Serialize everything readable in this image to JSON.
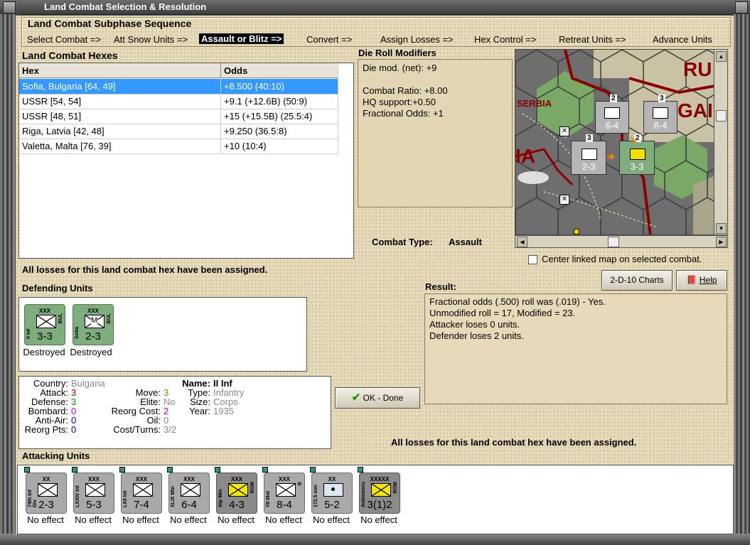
{
  "window": {
    "title": "Land Combat Selection & Resolution"
  },
  "subphase": {
    "title": "Land Combat Subphase Sequence",
    "steps": [
      "Select Combat =>",
      "Att Snow Units =>",
      "Assault or Blitz =>",
      "Convert =>",
      "Assign Losses =>",
      "Hex Control =>",
      "Retreat Units =>",
      "Advance Units"
    ],
    "active_index": 2
  },
  "hexes": {
    "title": "Land Combat Hexes",
    "columns": [
      "Hex",
      "Odds"
    ],
    "rows": [
      {
        "hex": "Sofia, Bulgaria [64, 49]",
        "odds": "+8.500 (40:10)"
      },
      {
        "hex": "USSR [54, 54]",
        "odds": "+9.1 (+12.6B) (50:9)"
      },
      {
        "hex": "USSR [48, 51]",
        "odds": "+15 (+15.5B) (25.5:4)"
      },
      {
        "hex": "Riga, Latvia [42, 48]",
        "odds": "+9.250 (36.5:8)"
      },
      {
        "hex": "Valetta, Malta [76, 39]",
        "odds": "+10 (10:4)"
      }
    ],
    "selected_index": 0
  },
  "drm": {
    "title": "Die Roll Modifiers",
    "lines": [
      "Die mod. (net): +9",
      "",
      "Combat Ratio: +8.00",
      "HQ support:+0.50",
      "Fractional Odds: +1"
    ]
  },
  "map": {
    "labels": [
      "RU",
      "GAI",
      "SERBIA",
      "IA"
    ],
    "counters": [
      {
        "top": "2",
        "str": "6-4"
      },
      {
        "top": "3",
        "str": "8-4"
      },
      {
        "top": "3",
        "str": "2-3"
      },
      {
        "top": "2",
        "str": "3-3"
      }
    ]
  },
  "combat_type": {
    "label": "Combat Type:",
    "value": "Assault"
  },
  "center_linked": {
    "label": "Center linked map on selected combat.",
    "checked": false
  },
  "losses_msg_top": "All losses for this land combat hex have been assigned.",
  "defending": {
    "title": "Defending Units",
    "units": [
      {
        "size": "XXX",
        "name": "II Inf",
        "nation": "BUL",
        "str": "3-3",
        "status": "Destroyed",
        "mark": ""
      },
      {
        "size": "XXX",
        "name": "Sofia",
        "nation": "BUL",
        "str": "2-3",
        "status": "Destroyed",
        "mark": "M"
      }
    ]
  },
  "buttons": {
    "charts": "2-D-10 Charts",
    "help": "Help",
    "done": "OK - Done"
  },
  "result": {
    "title": "Result:",
    "lines": [
      "Fractional odds (.500) roll was (.019)  - Yes.",
      "Unmodified roll = 17, Modified = 23.",
      "Attacker loses 0 units.",
      "Defender loses 2 units."
    ]
  },
  "unit_info": {
    "country_label": "Country:",
    "country": "Bulgaria",
    "attack_label": "Attack:",
    "attack": "3",
    "defense_label": "Defense:",
    "defense": "3",
    "bombard_label": "Bombard:",
    "bombard": "0",
    "antiair_label": "Anti-Air:",
    "antiair": "0",
    "reorgpts_label": "Reorg Pts:",
    "reorgpts": "0",
    "move_label": "Move:",
    "move": "3",
    "elite_label": "Elite:",
    "elite": "No",
    "reorgcost_label": "Reorg Cost:",
    "reorgcost": "2",
    "oil_label": "Oil:",
    "oil": "0",
    "costturns_label": "Cost/Turns:",
    "costturns": "3/2",
    "name_label": "Name:",
    "name": "II Inf",
    "type_label": "Type:",
    "type": "Infantry",
    "size_label": "Size:",
    "size": "Corps",
    "year_label": "Year:",
    "year": "1935"
  },
  "losses_msg_bottom": "All losses for this land combat hex have been assigned.",
  "attacking": {
    "title": "Attacking Units",
    "units": [
      {
        "size": "XX",
        "name": "74th Inf Div",
        "nation": "",
        "str": "2-3",
        "status": "No effect",
        "style": "grey"
      },
      {
        "size": "XXX",
        "name": "LXXIV Inf",
        "nation": "",
        "str": "5-3",
        "status": "No effect",
        "style": "grey"
      },
      {
        "size": "XXX",
        "name": "LXII Inf",
        "nation": "",
        "str": "7-4",
        "status": "No effect",
        "style": "grey"
      },
      {
        "size": "XXX",
        "name": "XLIX Mtn",
        "nation": "",
        "str": "6-4",
        "status": "No effect",
        "style": "grey"
      },
      {
        "size": "XXX",
        "name": "Alp Mtn",
        "nation": "ROM",
        "str": "4-3",
        "status": "No effect",
        "style": "dark"
      },
      {
        "size": "XXX",
        "name": "VII Mot",
        "nation": "R",
        "str": "8-4",
        "status": "No effect",
        "style": "grey"
      },
      {
        "size": "XX",
        "name": "172.5 mm",
        "nation": "",
        "str": "5-2",
        "status": "No effect",
        "style": "grey"
      },
      {
        "size": "XXXXX",
        "name": "Antonescu",
        "nation": "ROM",
        "str": "3(1)2",
        "status": "No effect",
        "style": "dark"
      }
    ]
  },
  "colors": {
    "selected_row": "#3399ff",
    "panel_bg": "#e6d9b8",
    "border_red": "#8b0000"
  }
}
